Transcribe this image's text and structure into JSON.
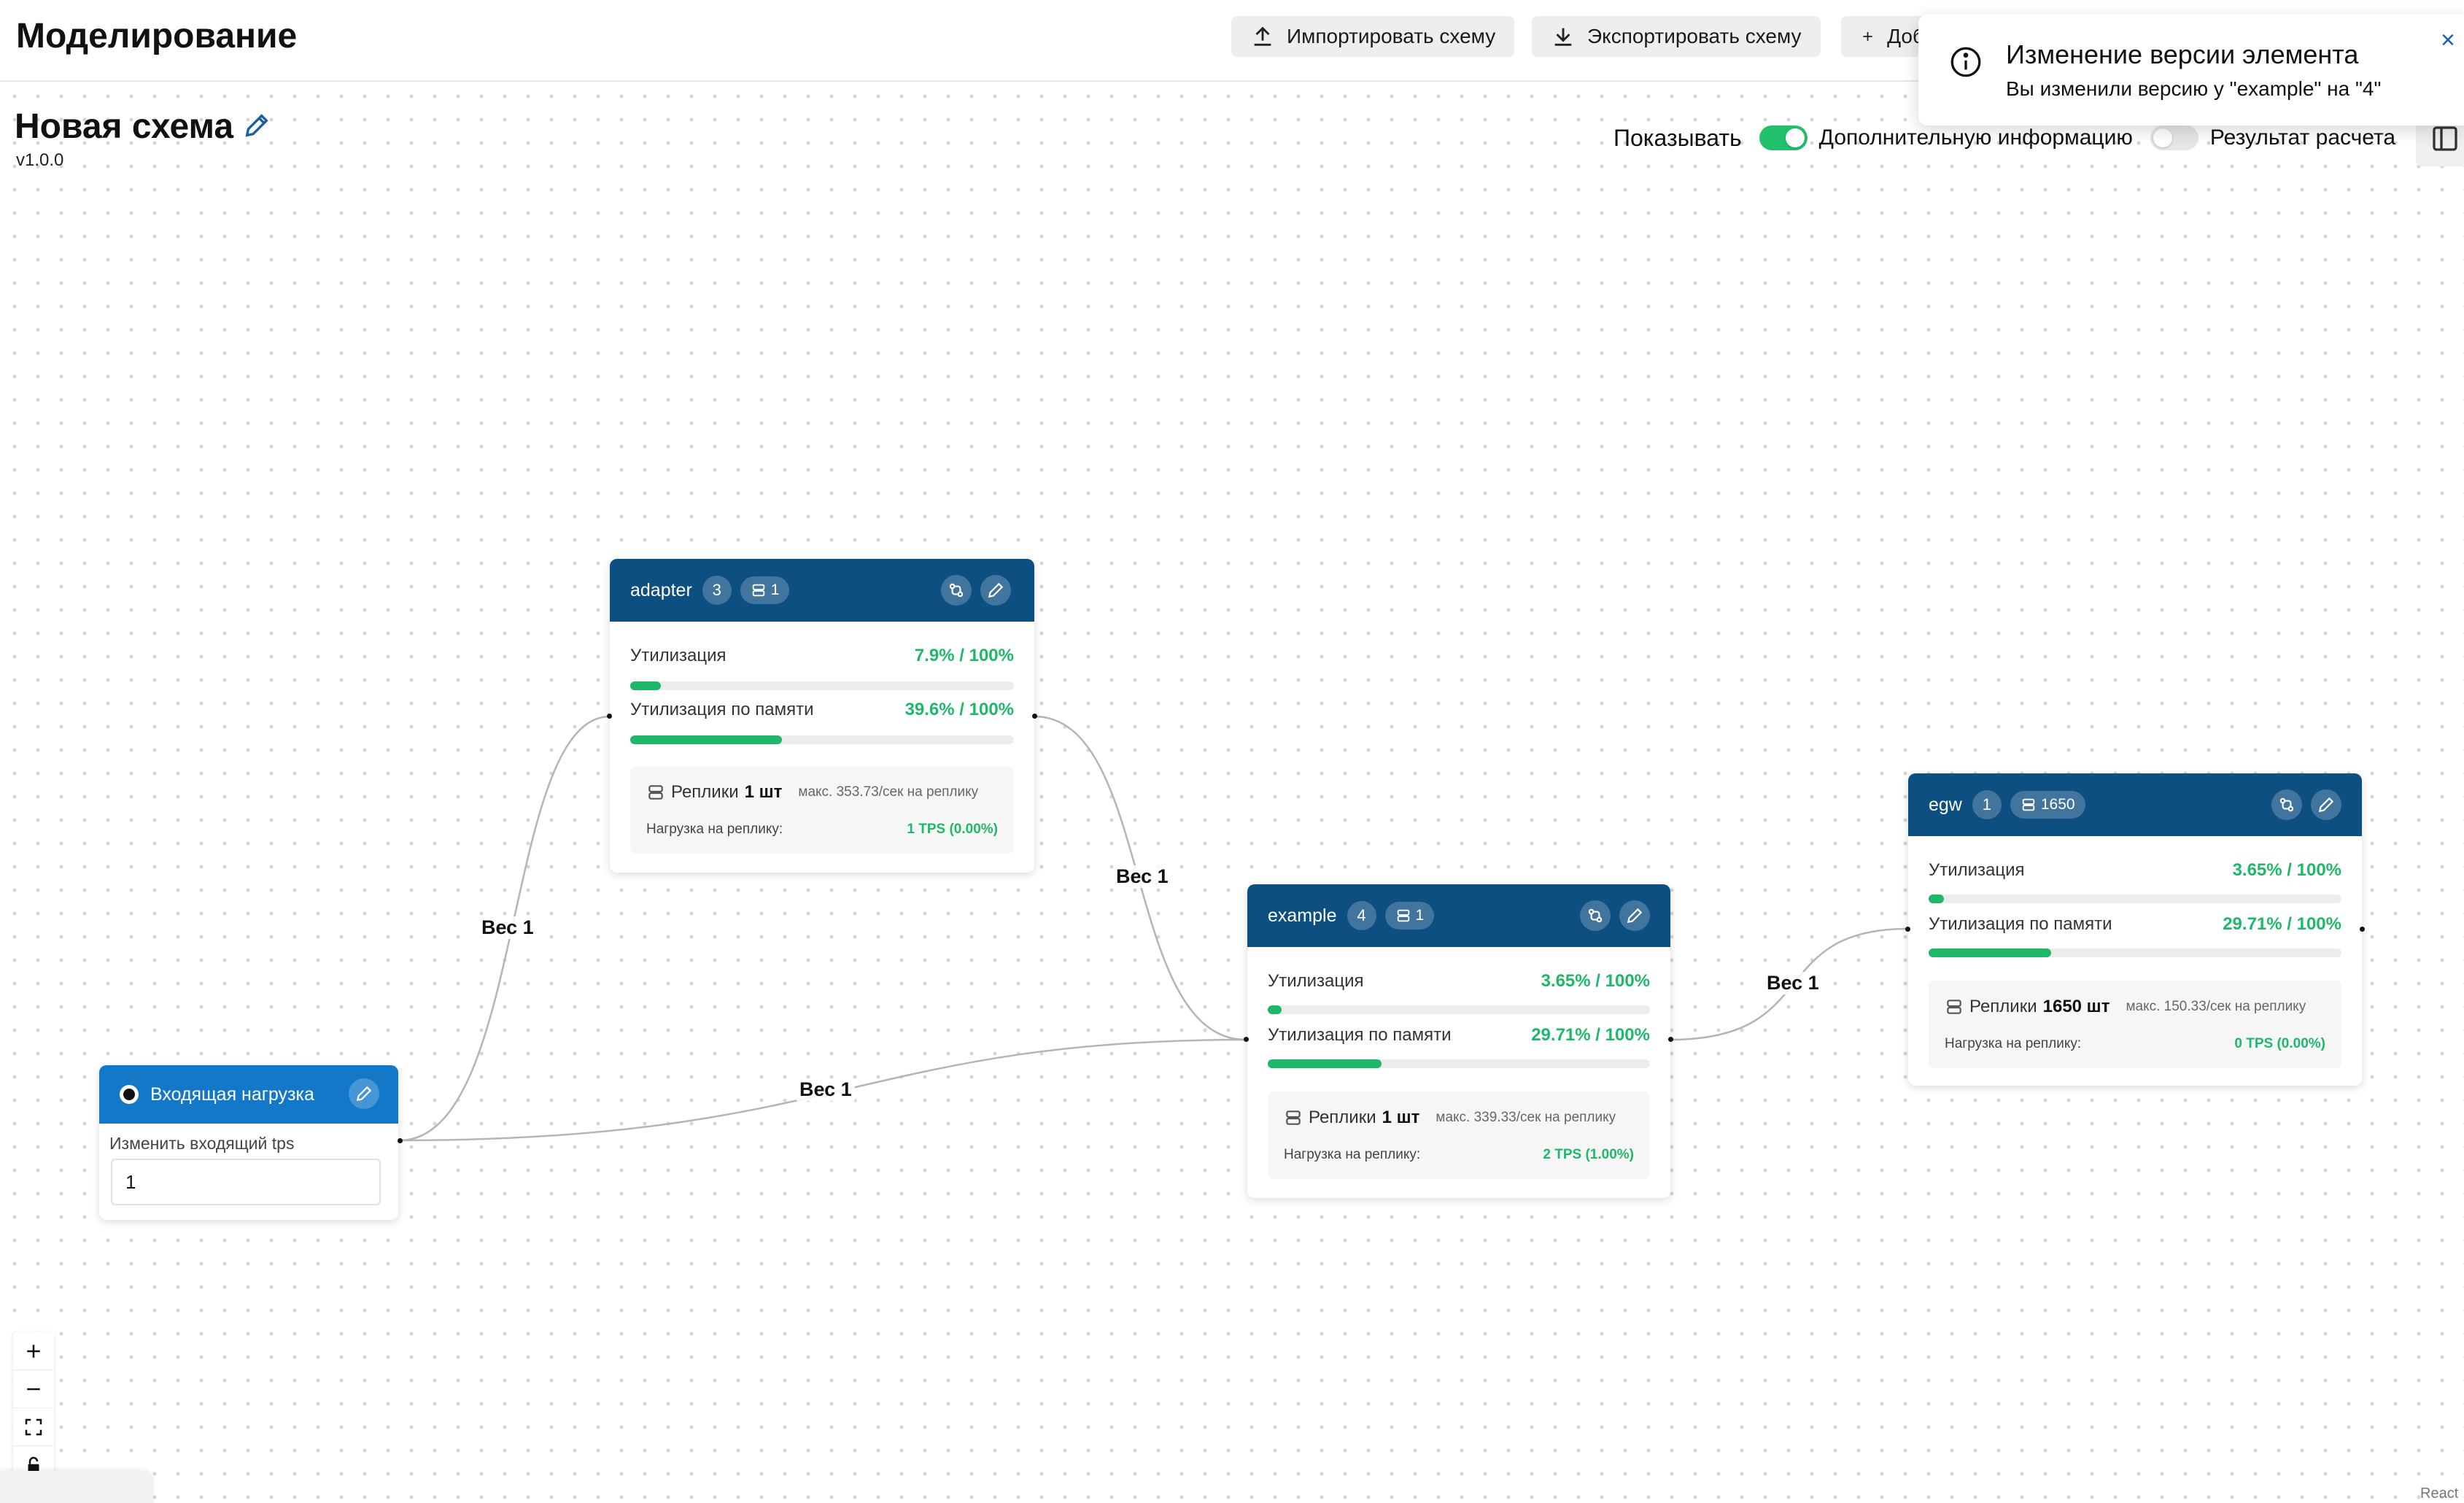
{
  "header": {
    "title": "Моделирование",
    "import_label": "Импортировать схему",
    "export_label": "Экспортировать схему",
    "add_label": "Доб"
  },
  "scheme": {
    "title": "Новая схема",
    "version": "v1.0.0"
  },
  "display": {
    "show_label": "Показывать",
    "extra_info_label": "Дополнительную информацию",
    "extra_info_on": true,
    "calc_result_label": "Результат расчета",
    "calc_result_on": false
  },
  "toast": {
    "title": "Изменение версии элемента",
    "message": "Вы изменили версию у \"example\" на \"4\"",
    "close": "×"
  },
  "nodes": {
    "adapter": {
      "name": "adapter",
      "version": "3",
      "replicas_badge": "1",
      "cpu_label": "Утилизация",
      "cpu_value": "7.9% / 100%",
      "cpu_fraction": 0.079,
      "mem_label": "Утилизация по памяти",
      "mem_value": "39.6% / 100%",
      "mem_fraction": 0.396,
      "replicas_label": "Реплики",
      "replicas_count": "1 шт",
      "replicas_max": "макс. 353.73/сек на реплику",
      "load_label": "Нагрузка на реплику:",
      "load_value": "1 TPS  (0.00%)"
    },
    "example": {
      "name": "example",
      "version": "4",
      "replicas_badge": "1",
      "cpu_label": "Утилизация",
      "cpu_value": "3.65% / 100%",
      "cpu_fraction": 0.0365,
      "mem_label": "Утилизация по памяти",
      "mem_value": "29.71% / 100%",
      "mem_fraction": 0.2971,
      "replicas_label": "Реплики",
      "replicas_count": "1 шт",
      "replicas_max": "макс. 339.33/сек на реплику",
      "load_label": "Нагрузка на реплику:",
      "load_value": "2 TPS  (1.00%)"
    },
    "egw": {
      "name": "egw",
      "version": "1",
      "replicas_badge": "1650",
      "cpu_label": "Утилизация",
      "cpu_value": "3.65% / 100%",
      "cpu_fraction": 0.0365,
      "mem_label": "Утилизация по памяти",
      "mem_value": "29.71% / 100%",
      "mem_fraction": 0.2971,
      "replicas_label": "Реплики",
      "replicas_count": "1650 шт",
      "replicas_max": "макс. 150.33/сек на реплику",
      "load_label": "Нагрузка на реплику:",
      "load_value": "0 TPS  (0.00%)"
    },
    "input": {
      "title": "Входящая нагрузка",
      "tps_label": "Изменить входящий tps",
      "tps_value": "1"
    }
  },
  "edges": {
    "input_adapter": "Вес 1",
    "input_example": "Вес 1",
    "adapter_example": "Вес 1",
    "example_egw": "Вес 1"
  },
  "footer": {
    "attribution": "React"
  },
  "colors": {
    "node_header": "#0e4f82",
    "input_header": "#1378c8",
    "accent_green": "#1fb86a"
  }
}
